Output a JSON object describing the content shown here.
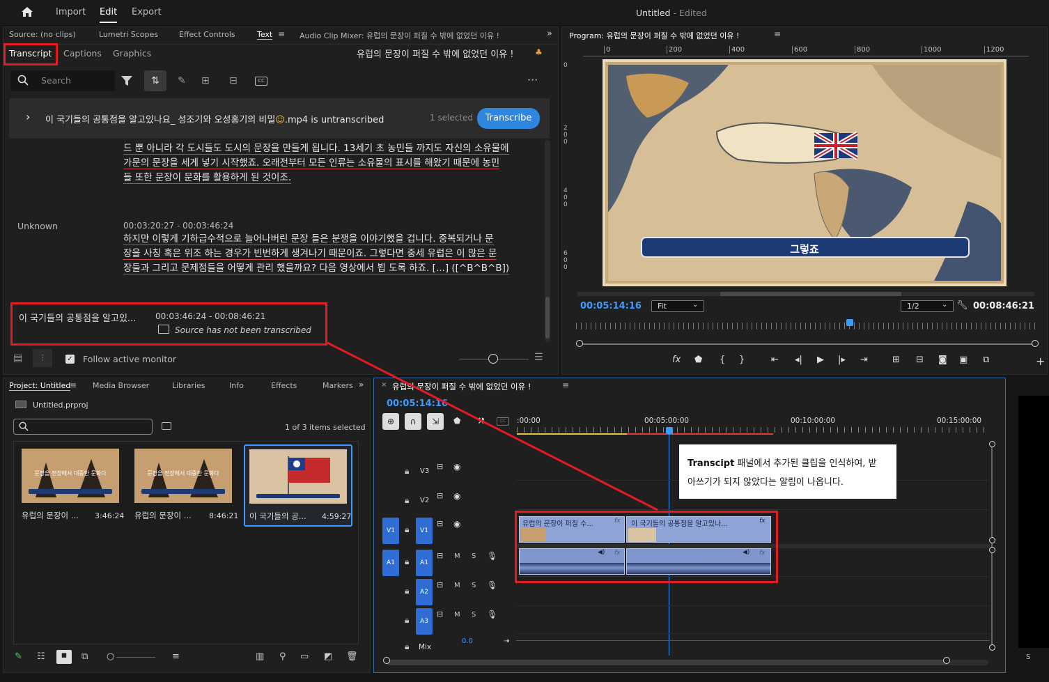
{
  "menu": {
    "import": "Import",
    "edit": "Edit",
    "export": "Export",
    "title_name": "Untitled",
    "title_suffix": "- Edited"
  },
  "source_tabs": {
    "source": "Source: (no clips)",
    "lumetri": "Lumetri Scopes",
    "effect_controls": "Effect Controls",
    "text": "Text",
    "audio_mixer": "Audio Clip Mixer: 유럽의 문장이 퍼질 수 밖에 없었던 이유 !"
  },
  "text_subtabs": {
    "transcript": "Transcript",
    "captions": "Captions",
    "graphics": "Graphics",
    "sequence_name": "유럽의 문장이 퍼질 수 밖에 없었던 이유 !"
  },
  "search": {
    "placeholder": "Search"
  },
  "banner": {
    "clip": "이 국기들의 공통점을 알고있나요_ 성조기와 오성홍기의 비밀",
    "ext": ".mp4 is untranscribed",
    "selected": "1 selected",
    "transcribe": "Transcribe"
  },
  "transcript": {
    "seg1_lines": [
      "드 뿐 아니라 각 도시들도 도시의 문장을 만들게 됩니다. 13세기 초 농민들 까지도 자신의 소유물에",
      "가문의 문장을 세게 넣기 시작했죠. 오래전부터 모든 인류는 소유물의 표시를 해왔기 때문에 농민",
      "들 또한 문장이 문화를 활용하게 된 것이조."
    ],
    "speaker": "Unknown",
    "seg2_time": "00:03:20:27 - 00:03:46:24",
    "seg2_lines": [
      "하지만 이렇게 기하급수적으로 늘어나버린 문장 들은 분쟁을 이야기했을 겁니다. 중복되거나 문",
      "장을 사칭 혹은 위조 하는 경우가 빈번하게 생겨나기 때문이죠. 그렇다면 중세 유럽은 이 많은 문",
      "장들과 그리고 문제점들을 어떻게 관리 했을까요? 다음 영상에서 뵙 도록 하죠. [...] ([^B^B^B])"
    ],
    "untrans_name": "이 국기들의 공통점을 알고있...",
    "untrans_time": "00:03:46:24 - 00:08:46:21",
    "untrans_msg": "Source has not been transcribed",
    "follow": "Follow active monitor"
  },
  "program": {
    "title": "Program: 유럽의 문장이 퍼질 수 밖에 없었던 이유 !",
    "ruler": [
      "0",
      "200",
      "400",
      "600",
      "800",
      "1000",
      "1200"
    ],
    "vruler": [
      "0",
      "2 0 0",
      "4 0 0",
      "6 0 0"
    ],
    "caption": "그렇죠",
    "timecode": "00:05:14:16",
    "fit": "Fit",
    "quality": "1/2",
    "duration": "00:08:46:21"
  },
  "project": {
    "tabs": [
      "Project: Untitled",
      "Media Browser",
      "Libraries",
      "Info",
      "Effects",
      "Markers"
    ],
    "file": "Untitled.prproj",
    "count": "1 of 3 items selected",
    "items": [
      {
        "name": "유럽의 문장이 ...",
        "dur": "3:46:24",
        "thumb_text": "문장을 전장에서 대중한 문화다"
      },
      {
        "name": "유럽의 문장이 ...",
        "dur": "8:46:21",
        "thumb_text": "문장을 전장에서 대중한 문화다"
      },
      {
        "name": "이 국기들의 공...",
        "dur": "4:59:27",
        "thumb_text": ""
      }
    ]
  },
  "timeline": {
    "title": "유럽의 문장이 퍼질 수 밖에 없었던 이유 !",
    "timecode": "00:05:14:16",
    "ruler": [
      ":00:00",
      "00:05:00:00",
      "00:10:00:00",
      "00:15:00:00"
    ],
    "tracks": {
      "v3": "V3",
      "v2": "V2",
      "v1": "V1",
      "a1": "A1",
      "a2": "A2",
      "a3": "A3",
      "mix": "Mix",
      "mixval": "0.0",
      "m": "M",
      "s": "S"
    },
    "clip1": "유럽의 문장이 퍼질 수...",
    "clip2": "이 국기들의 공통점을 알고있나...",
    "fx": "fx"
  },
  "annotation": {
    "bold": "Transcipt",
    "rest": " 패널에서 추가된 클립을 인식하여, 받",
    "line2": "아쓰기가 되지 않았다는 알림이 나옵니다."
  },
  "right_panel": {
    "letter": "S"
  },
  "colors": {
    "accent": "#2e86de",
    "highlight": "#e31b23"
  }
}
